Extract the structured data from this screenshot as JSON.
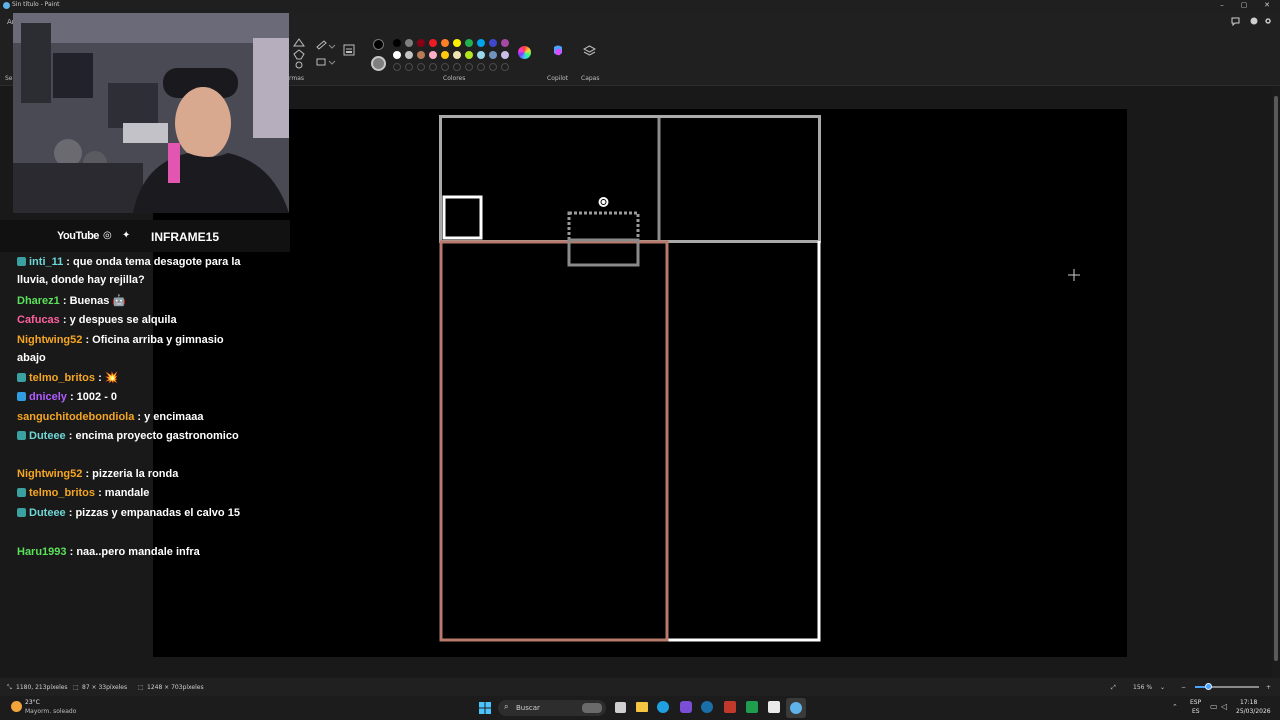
{
  "window": {
    "title": "Sin título - Paint",
    "controls": [
      "–",
      "▢",
      "✕"
    ]
  },
  "ribbon": {
    "truncated_left": "Ar",
    "truncated_sel": "Sel",
    "shapes_label": "rmas",
    "colors_label": "Colores",
    "copilot_label": "Copilot",
    "layers_label": "Capas",
    "palette_row1": [
      "#000000",
      "#7f7f7f",
      "#880015",
      "#ed1c24",
      "#ff7f27",
      "#fff200",
      "#22b14c",
      "#00a2e8",
      "#3f48cc",
      "#a349a4"
    ],
    "palette_row2": [
      "#ffffff",
      "#c3c3c3",
      "#b97a57",
      "#ffaec9",
      "#ffc90e",
      "#efe4b0",
      "#b5e61d",
      "#99d9ea",
      "#7092be",
      "#c8bfe7"
    ]
  },
  "overlay": {
    "youtube_label": "YouTube",
    "channel_name": "INFRAME15"
  },
  "chat": [
    {
      "user": "inti_11",
      "user_color": "#6fd6d6",
      "text": " : que onda tema desagote para la lluvia, donde hay rejilla?",
      "badge": "#3aa0a0"
    },
    {
      "user": "Dharez1",
      "user_color": "#5be05b",
      "text": " : Buenas 🤖",
      "badge": ""
    },
    {
      "user": "Cafucas",
      "user_color": "#ff5f9e",
      "text": " : y despues se alquila",
      "badge": ""
    },
    {
      "user": "Nightwing52",
      "user_color": "#f5a623",
      "text": " : Oficina arriba y gimnasio abajo",
      "badge": ""
    },
    {
      "user": "telmo_britos",
      "user_color": "#f5a623",
      "text": " : 💥",
      "badge": "#3aa0a0"
    },
    {
      "user": "dnicely",
      "user_color": "#b05cff",
      "text": " : 1002 - 0",
      "badge": "#2f9de0"
    },
    {
      "user": "sanguchitodebondiola",
      "user_color": "#f5a623",
      "text": " : y encimaaa",
      "badge": ""
    },
    {
      "user": "Duteee",
      "user_color": "#6fd6d6",
      "text": " : encima proyecto gastronomico",
      "badge": "#3aa0a0"
    },
    {
      "user": "Nightwing52",
      "user_color": "#f5a623",
      "text": " : pizzeria la ronda",
      "badge": ""
    },
    {
      "user": "telmo_britos",
      "user_color": "#f5a623",
      "text": " : mandale",
      "badge": "#3aa0a0"
    },
    {
      "user": "Duteee",
      "user_color": "#6fd6d6",
      "text": " : pizzas y empanadas el calvo 15",
      "badge": "#3aa0a0"
    },
    {
      "user": "Haru1993",
      "user_color": "#5be05b",
      "text": " : naa..pero mandale infra",
      "badge": ""
    }
  ],
  "status": {
    "cursor_pos": "1180, 213píxeles",
    "selection_size": "87 × 33píxeles",
    "canvas_size": "1248 × 703píxeles",
    "zoom": "156 %"
  },
  "taskbar": {
    "weather_temp": "23°C",
    "weather_desc": "Mayorm. soleado",
    "search_placeholder": "Buscar",
    "lang_top": "ESP",
    "lang_bottom": "ES",
    "time": "17:18",
    "date": "25/03/2026"
  }
}
